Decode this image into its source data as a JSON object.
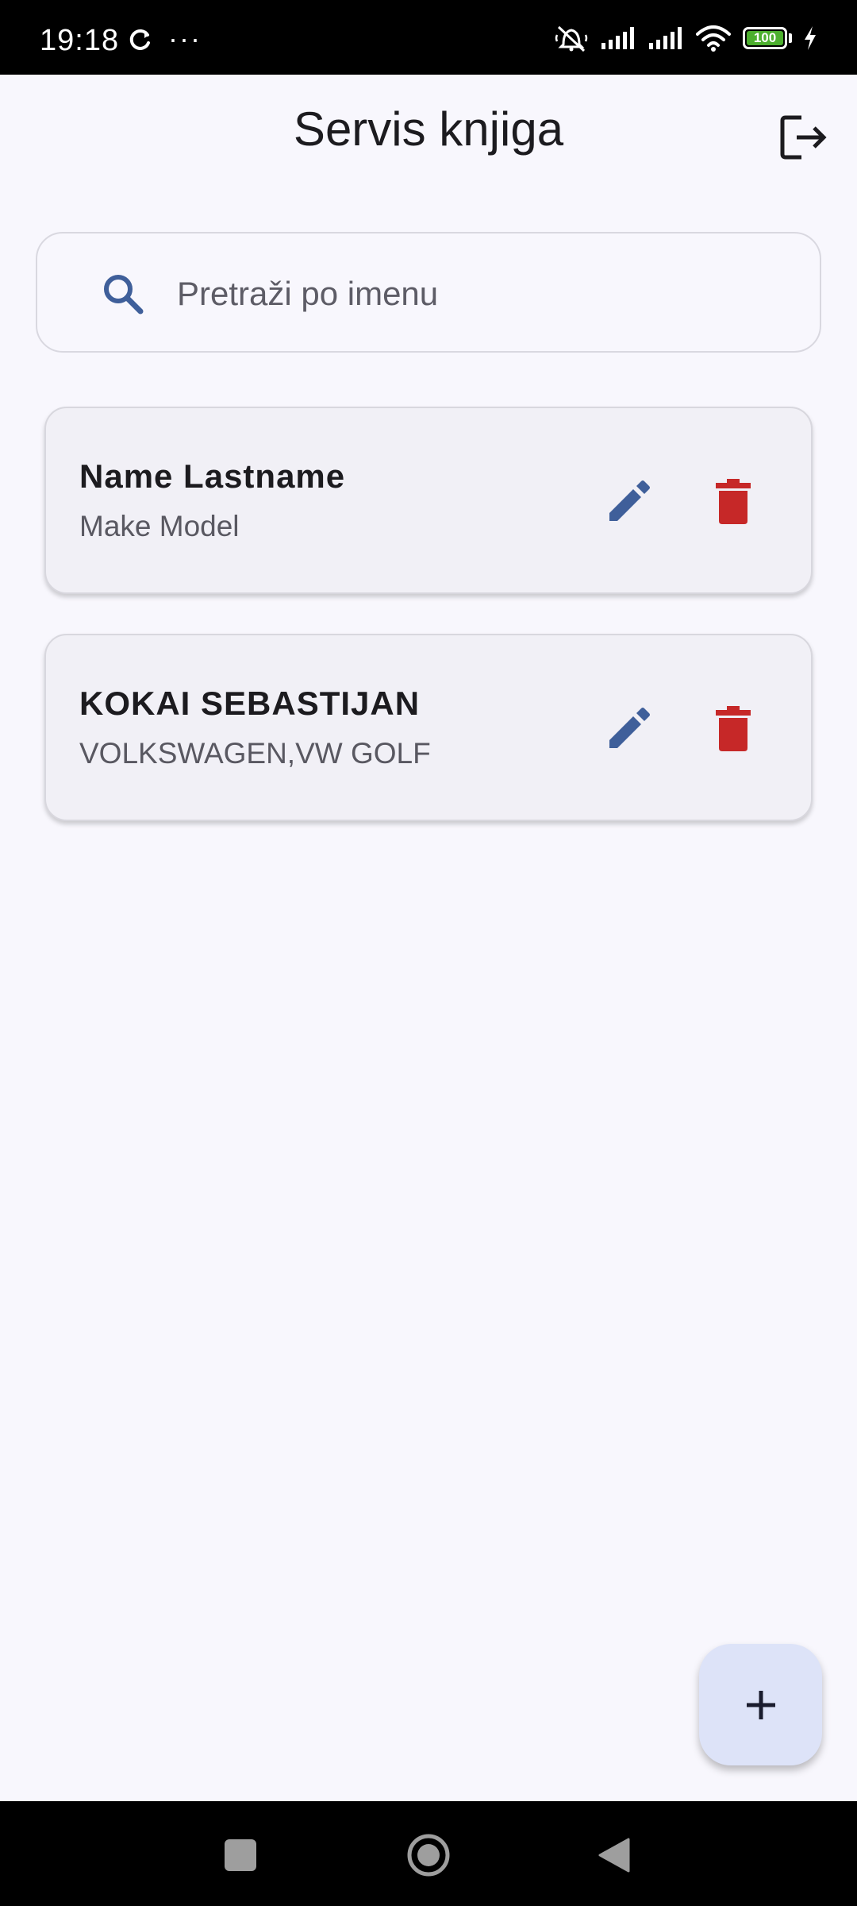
{
  "status_bar": {
    "time": "19:18",
    "more": "···",
    "battery_level": "100",
    "icons": [
      "sync-icon",
      "mute-icon",
      "signal-icon",
      "signal-icon",
      "wifi-icon",
      "battery-icon",
      "charging-icon"
    ]
  },
  "header": {
    "title": "Servis knjiga",
    "logout_icon": "logout-icon"
  },
  "search": {
    "placeholder": "Pretraži po imenu",
    "value": ""
  },
  "records": [
    {
      "name": "Name Lastname",
      "vehicle": "Make Model"
    },
    {
      "name": "KOKAI SEBASTIJAN",
      "vehicle": "VOLKSWAGEN,VW GOLF"
    }
  ],
  "fab": {
    "icon": "plus-icon"
  },
  "navigation": {
    "items": [
      "recents-button",
      "home-button",
      "back-button"
    ]
  },
  "colors": {
    "background": "#f8f7fd",
    "card": "#f1f0f6",
    "edit": "#3f5f9a",
    "delete": "#c62828",
    "fab": "#dde3f8"
  }
}
